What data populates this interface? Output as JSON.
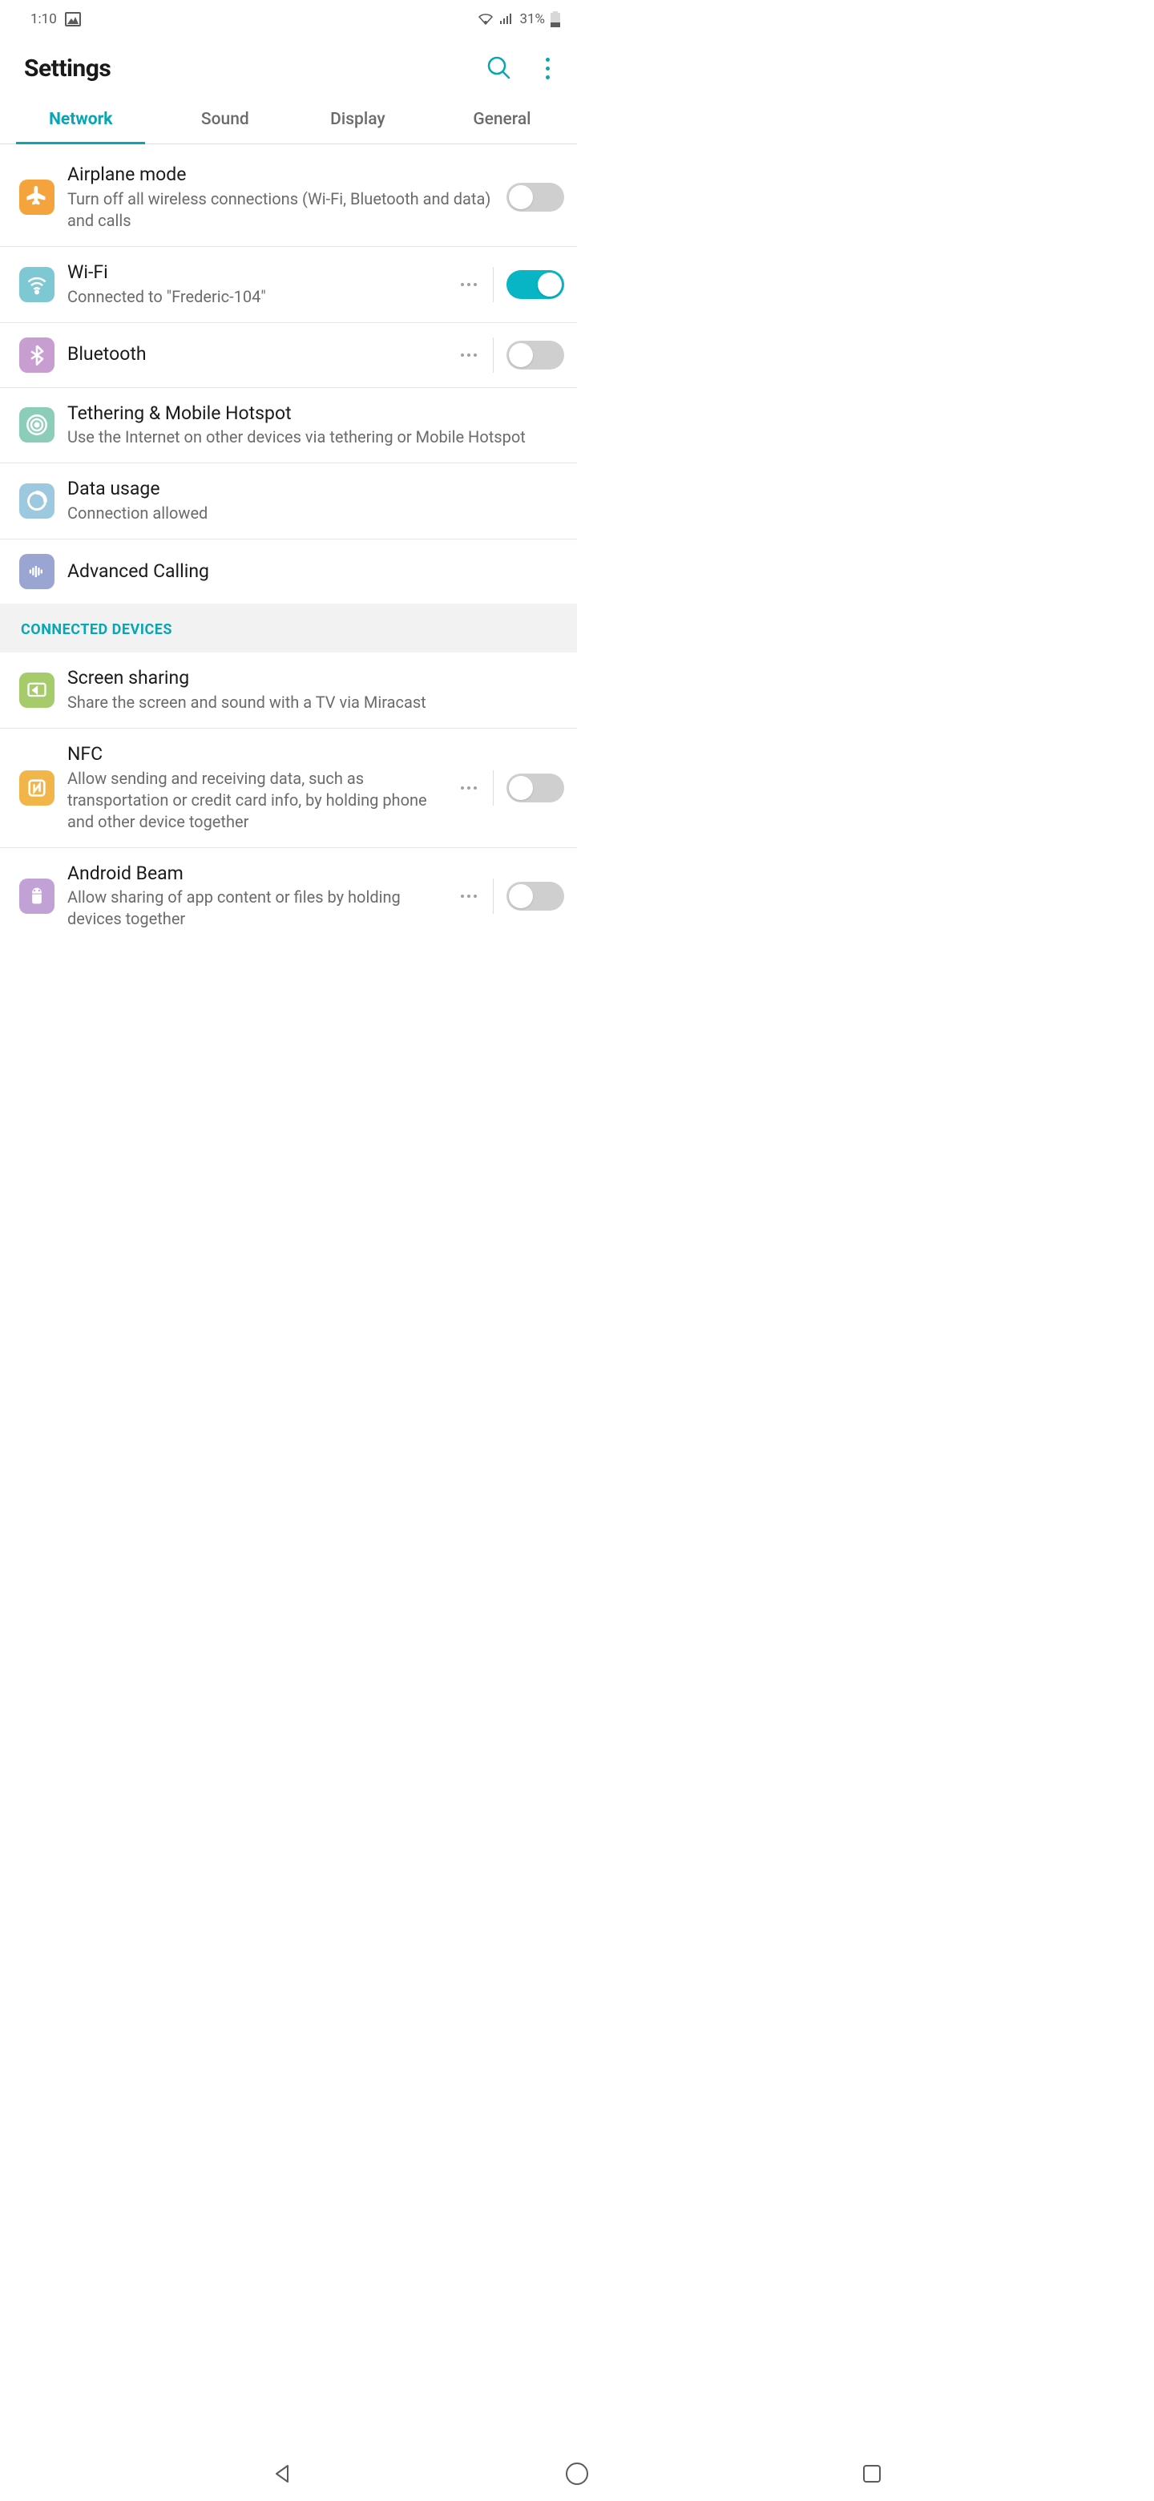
{
  "status": {
    "time": "1:10",
    "battery_pct": "31%"
  },
  "header": {
    "title": "Settings"
  },
  "tabs": {
    "network": "Network",
    "sound": "Sound",
    "display": "Display",
    "general": "General"
  },
  "items": {
    "airplane": {
      "title": "Airplane mode",
      "sub": "Turn off all wireless connections (Wi-Fi, Bluetooth and data) and calls",
      "enabled": false
    },
    "wifi": {
      "title": "Wi-Fi",
      "sub": "Connected to \"Frederic-104\"",
      "enabled": true
    },
    "bluetooth": {
      "title": "Bluetooth",
      "enabled": false
    },
    "tethering": {
      "title": "Tethering & Mobile Hotspot",
      "sub": "Use the Internet on other devices via tethering or Mobile Hotspot"
    },
    "data": {
      "title": "Data usage",
      "sub": "Connection allowed"
    },
    "advcall": {
      "title": "Advanced Calling"
    },
    "screenshare": {
      "title": "Screen sharing",
      "sub": "Share the screen and sound with a TV via Miracast"
    },
    "nfc": {
      "title": "NFC",
      "sub": "Allow sending and receiving data, such as transportation or credit card info, by holding phone and other device together",
      "enabled": false
    },
    "beam": {
      "title": "Android Beam",
      "sub": "Allow sharing of app content or files by holding devices together",
      "enabled": false
    }
  },
  "sections": {
    "connected_devices": "CONNECTED DEVICES"
  }
}
